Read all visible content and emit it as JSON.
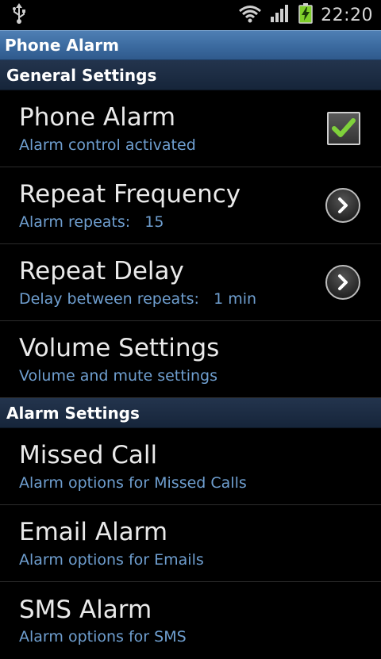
{
  "status_bar": {
    "time": "22:20",
    "icons": [
      "usb-icon",
      "wifi-icon",
      "signal-icon",
      "battery-charging-icon"
    ]
  },
  "app": {
    "title": "Phone Alarm"
  },
  "sections": [
    {
      "title": "General Settings",
      "items": [
        {
          "title": "Phone Alarm",
          "summary": "Alarm control activated",
          "widget": "checkbox",
          "checked": true
        },
        {
          "title": "Repeat Frequency",
          "summary": "Alarm repeats:   15",
          "widget": "chevron"
        },
        {
          "title": "Repeat Delay",
          "summary": "Delay between repeats:   1 min",
          "widget": "chevron"
        },
        {
          "title": "Volume Settings",
          "summary": "Volume and mute settings",
          "widget": "none"
        }
      ]
    },
    {
      "title": "Alarm Settings",
      "items": [
        {
          "title": "Missed Call",
          "summary": "Alarm options for Missed Calls",
          "widget": "none"
        },
        {
          "title": "Email Alarm",
          "summary": "Alarm options for Emails",
          "widget": "none"
        },
        {
          "title": "SMS Alarm",
          "summary": "Alarm options for SMS",
          "widget": "none"
        }
      ]
    }
  ],
  "colors": {
    "summary_text": "#6f9fd0",
    "checkmark": "#7fd13b",
    "title_bar": "#3b6a9f",
    "section_header": "#1c2d44"
  }
}
